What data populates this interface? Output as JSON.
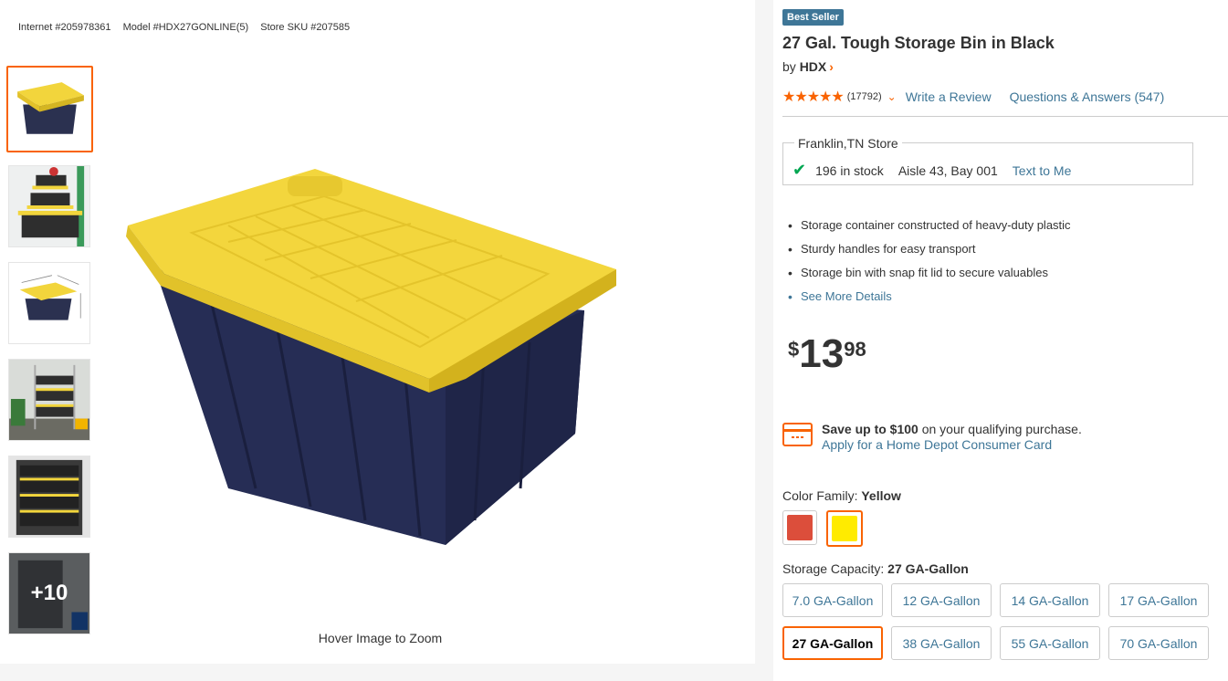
{
  "product_ids": {
    "internet": "Internet #205978361",
    "model": "Model #HDX27GONLINE(5)",
    "sku": "Store SKU #207585"
  },
  "gallery": {
    "more_label": "+10",
    "hover_hint": "Hover Image to Zoom"
  },
  "badge": "Best Seller",
  "title": "27 Gal. Tough Storage Bin in Black",
  "brand": {
    "by": "by",
    "name": "HDX",
    "chevron": "›"
  },
  "rating": {
    "stars": "★★★★★",
    "count": "(17792)",
    "write_review": "Write a Review",
    "qa": "Questions & Answers (547)"
  },
  "store": {
    "name": "Franklin,TN Store",
    "stock": "196 in stock",
    "aisle": "Aisle 43, Bay 001",
    "text_me": "Text to Me"
  },
  "highlights": [
    "Storage container constructed of heavy-duty plastic",
    "Sturdy handles for easy transport",
    "Storage bin with snap fit lid to secure valuables"
  ],
  "see_more": "See More Details",
  "price": {
    "currency": "$",
    "whole": "13",
    "cents": "98"
  },
  "promo": {
    "bold": "Save up to $100",
    "rest": " on your qualifying purchase.",
    "link": "Apply for a Home Depot Consumer Card"
  },
  "color": {
    "label": "Color Family: ",
    "value": "Yellow",
    "swatches": [
      "#dc4e3b",
      "#ffeb00"
    ]
  },
  "capacity": {
    "label": "Storage Capacity: ",
    "value": "27 GA-Gallon",
    "options": [
      "7.0 GA-Gallon",
      "12 GA-Gallon",
      "14 GA-Gallon",
      "17 GA-Gallon",
      "27 GA-Gallon",
      "38 GA-Gallon",
      "55 GA-Gallon",
      "70 GA-Gallon"
    ]
  },
  "colors": {
    "accent": "#f96302",
    "link": "#3e7697",
    "badge": "#3e7697",
    "stock_check": "#00a651"
  }
}
